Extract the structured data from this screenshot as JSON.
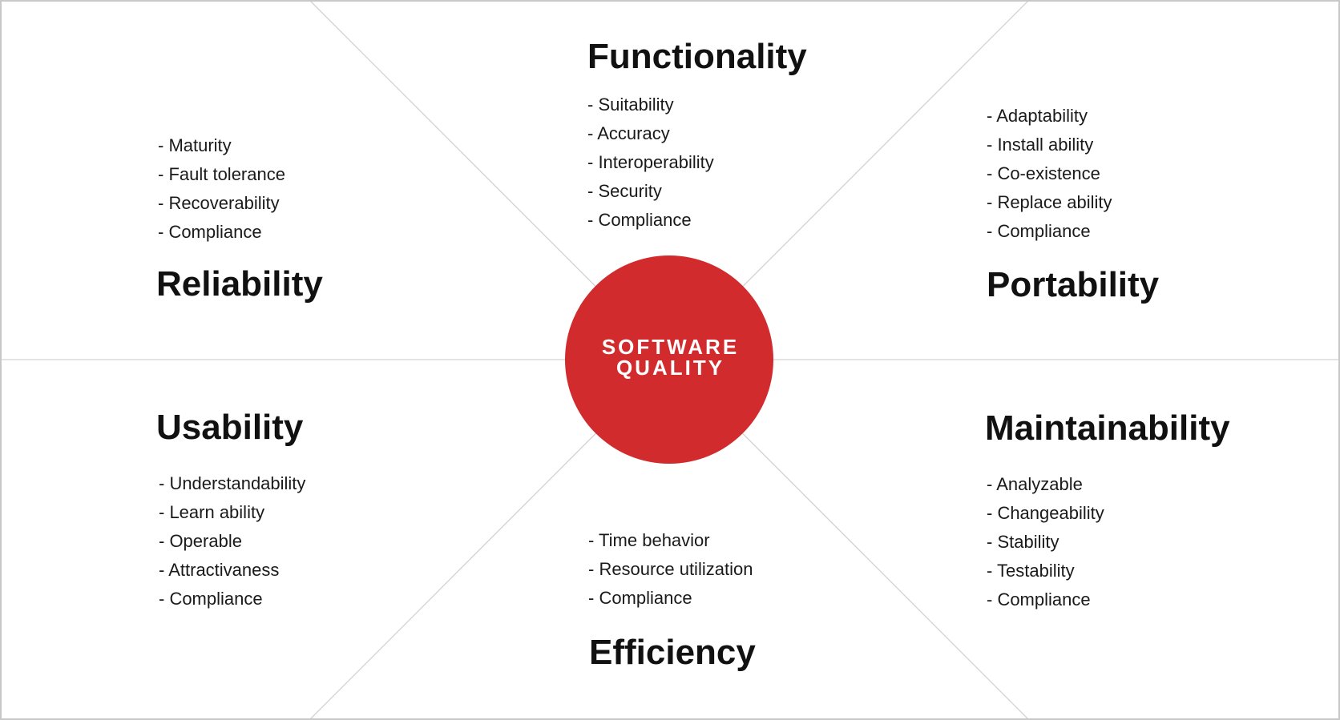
{
  "center": {
    "line1": "SOFTWARE",
    "line2": "QUALITY",
    "color": "#d12b2e"
  },
  "divider_color": "#d2d2d2",
  "border_color": "#c8c8c8",
  "categories": {
    "functionality": {
      "title": "Functionality",
      "items": [
        "- Suitability",
        "- Accuracy",
        "- Interoperability",
        "- Security",
        "- Compliance"
      ]
    },
    "reliability": {
      "title": "Reliability",
      "items": [
        "- Maturity",
        "- Fault tolerance",
        "- Recoverability",
        "- Compliance"
      ]
    },
    "portability": {
      "title": "Portability",
      "items": [
        "- Adaptability",
        "- Install ability",
        "- Co-existence",
        "- Replace ability",
        "- Compliance"
      ]
    },
    "usability": {
      "title": "Usability",
      "items": [
        "- Understandability",
        "- Learn ability",
        "- Operable",
        "- Attractivaness",
        "- Compliance"
      ]
    },
    "efficiency": {
      "title": "Efficiency",
      "items": [
        "- Time behavior",
        "- Resource utilization",
        "- Compliance"
      ]
    },
    "maintainability": {
      "title": "Maintainability",
      "items": [
        "- Analyzable",
        "- Changeability",
        "- Stability",
        "- Testability",
        "- Compliance"
      ]
    }
  }
}
